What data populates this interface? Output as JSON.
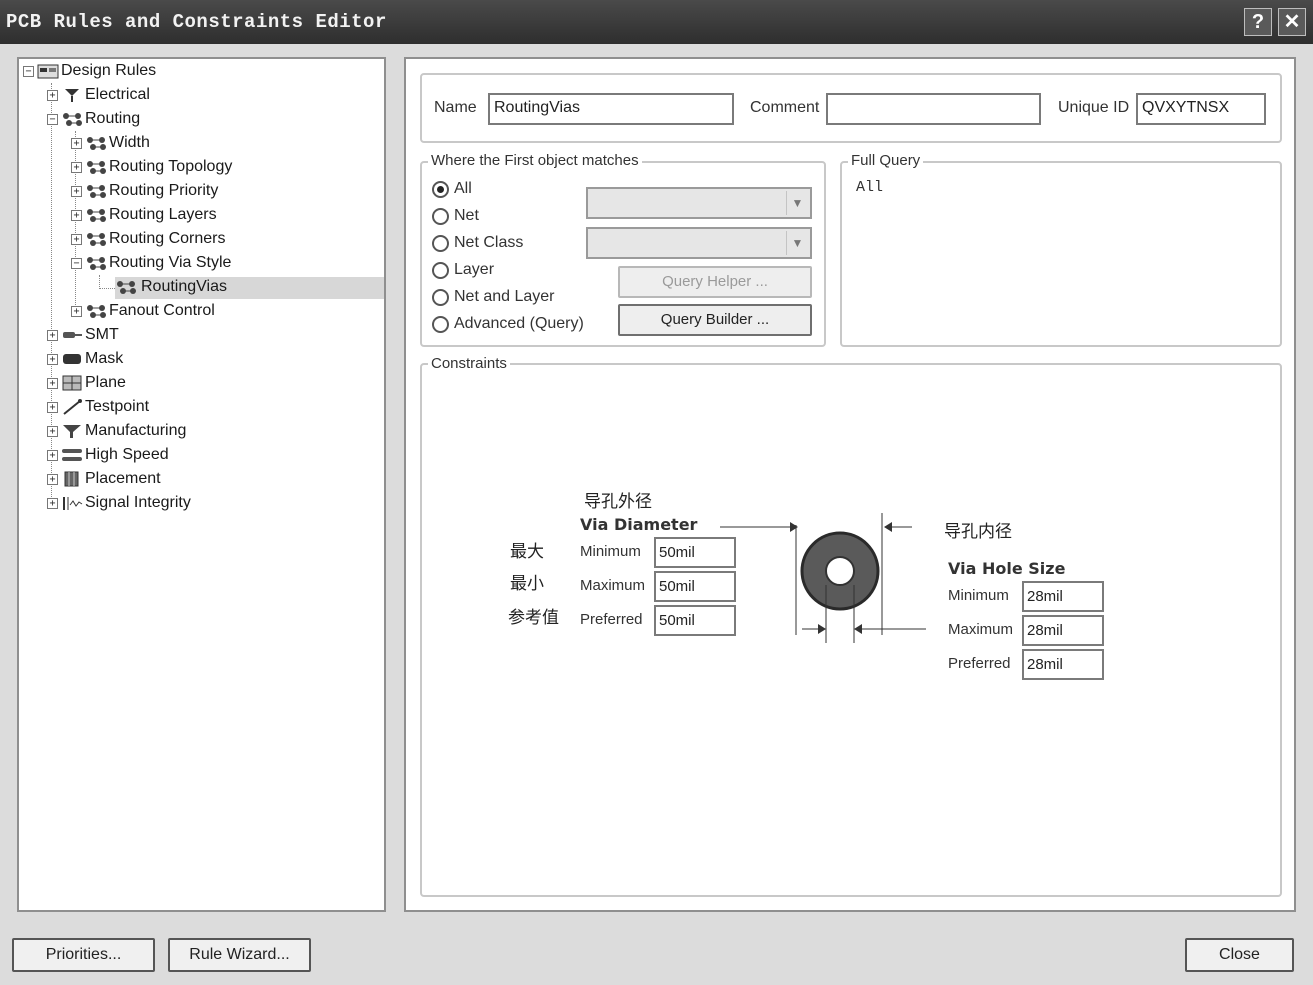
{
  "window": {
    "title": "PCB Rules and Constraints Editor",
    "help_glyph": "?",
    "close_glyph": "✕"
  },
  "tree": {
    "items": [
      {
        "label": "Design Rules",
        "icon": "rules-root-icon"
      },
      {
        "label": "Electrical",
        "icon": "electrical-icon"
      },
      {
        "label": "Routing",
        "icon": "routing-icon"
      },
      {
        "label": "Width",
        "icon": "routing-icon"
      },
      {
        "label": "Routing Topology",
        "icon": "routing-icon"
      },
      {
        "label": "Routing Priority",
        "icon": "routing-icon"
      },
      {
        "label": "Routing Layers",
        "icon": "routing-icon"
      },
      {
        "label": "Routing Corners",
        "icon": "routing-icon"
      },
      {
        "label": "Routing Via Style",
        "icon": "routing-icon"
      },
      {
        "label": "RoutingVias",
        "icon": "routing-icon"
      },
      {
        "label": "Fanout Control",
        "icon": "routing-icon"
      },
      {
        "label": "SMT",
        "icon": "smt-icon"
      },
      {
        "label": "Mask",
        "icon": "mask-icon"
      },
      {
        "label": "Plane",
        "icon": "plane-icon"
      },
      {
        "label": "Testpoint",
        "icon": "testpoint-icon"
      },
      {
        "label": "Manufacturing",
        "icon": "manufacturing-icon"
      },
      {
        "label": "High Speed",
        "icon": "high-speed-icon"
      },
      {
        "label": "Placement",
        "icon": "placement-icon"
      },
      {
        "label": "Signal Integrity",
        "icon": "signal-integrity-icon"
      }
    ],
    "selected": "RoutingVias"
  },
  "rule": {
    "name_label": "Name",
    "name_value": "RoutingVias",
    "comment_label": "Comment",
    "comment_value": "",
    "uid_label": "Unique ID",
    "uid_value": "QVXYTNSX"
  },
  "match": {
    "group_label": "Where the First object matches",
    "options": [
      "All",
      "Net",
      "Net Class",
      "Layer",
      "Net and Layer",
      "Advanced (Query)"
    ],
    "selected": "All",
    "query_helper": "Query Helper ...",
    "query_builder": "Query Builder ..."
  },
  "full_query": {
    "group_label": "Full Query",
    "text": "All"
  },
  "constraints": {
    "group_label": "Constraints",
    "via_diameter_cn": "导孔外径",
    "via_diameter_title": "Via Diameter",
    "side_max_cn": "最大",
    "side_min_cn": "最小",
    "side_pref_cn": "参考值",
    "via_hole_cn": "导孔内径",
    "via_hole_title": "Via Hole Size",
    "diameter": {
      "min_label": "Minimum",
      "min": "50mil",
      "max_label": "Maximum",
      "max": "50mil",
      "pref_label": "Preferred",
      "pref": "50mil"
    },
    "hole": {
      "min_label": "Minimum",
      "min": "28mil",
      "max_label": "Maximum",
      "max": "28mil",
      "pref_label": "Preferred",
      "pref": "28mil"
    }
  },
  "footer": {
    "priorities": "Priorities...",
    "rule_wizard": "Rule Wizard...",
    "close": "Close"
  }
}
